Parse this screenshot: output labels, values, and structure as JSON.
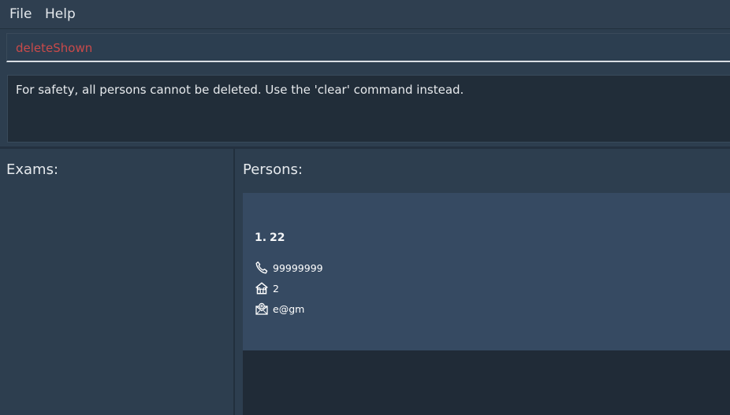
{
  "menu": {
    "file": "File",
    "help": "Help"
  },
  "command": {
    "value": "deleteShown"
  },
  "result": {
    "message": "For safety, all persons cannot be deleted. Use the 'clear' command instead."
  },
  "exams": {
    "title": "Exams:"
  },
  "persons": {
    "title": "Persons:",
    "items": [
      {
        "index": "1.",
        "name": "22",
        "phone": "99999999",
        "address": "2",
        "email": "e@gm",
        "phone_icon": "phone-icon",
        "address_icon": "house-icon",
        "email_icon": "email-icon"
      }
    ]
  },
  "colors": {
    "background": "#2d3e4f",
    "command_text": "#c94a4a",
    "card": "#364a62",
    "list_background": "#202b37"
  }
}
